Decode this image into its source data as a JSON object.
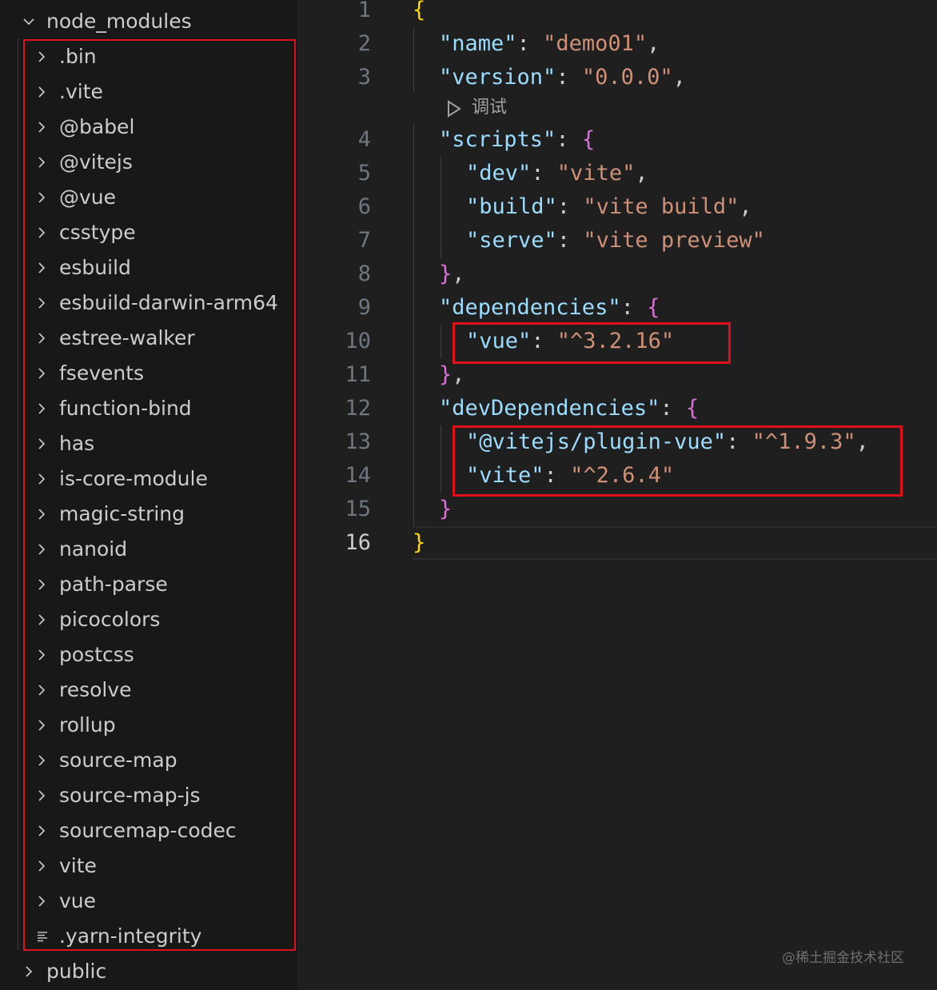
{
  "explorer": {
    "root_folder": "node_modules",
    "root_expanded": true,
    "items": [
      {
        "label": ".bin",
        "type": "folder"
      },
      {
        "label": ".vite",
        "type": "folder"
      },
      {
        "label": "@babel",
        "type": "folder"
      },
      {
        "label": "@vitejs",
        "type": "folder"
      },
      {
        "label": "@vue",
        "type": "folder"
      },
      {
        "label": "csstype",
        "type": "folder"
      },
      {
        "label": "esbuild",
        "type": "folder"
      },
      {
        "label": "esbuild-darwin-arm64",
        "type": "folder"
      },
      {
        "label": "estree-walker",
        "type": "folder"
      },
      {
        "label": "fsevents",
        "type": "folder"
      },
      {
        "label": "function-bind",
        "type": "folder"
      },
      {
        "label": "has",
        "type": "folder"
      },
      {
        "label": "is-core-module",
        "type": "folder"
      },
      {
        "label": "magic-string",
        "type": "folder"
      },
      {
        "label": "nanoid",
        "type": "folder"
      },
      {
        "label": "path-parse",
        "type": "folder"
      },
      {
        "label": "picocolors",
        "type": "folder"
      },
      {
        "label": "postcss",
        "type": "folder"
      },
      {
        "label": "resolve",
        "type": "folder"
      },
      {
        "label": "rollup",
        "type": "folder"
      },
      {
        "label": "source-map",
        "type": "folder"
      },
      {
        "label": "source-map-js",
        "type": "folder"
      },
      {
        "label": "sourcemap-codec",
        "type": "folder"
      },
      {
        "label": "vite",
        "type": "folder"
      },
      {
        "label": "vue",
        "type": "folder"
      },
      {
        "label": ".yarn-integrity",
        "type": "file"
      }
    ],
    "next_folder": "public",
    "icons": {
      "collapsed": "chevron-right-icon",
      "expanded": "chevron-down-icon",
      "file": "lines-file-icon"
    }
  },
  "editor": {
    "active_line": 16,
    "codelens_label": "调试",
    "codelens_icon": "play-outline-icon",
    "colors": {
      "key": "#9cdcfe",
      "string": "#ce9178",
      "bracket_level1": "#ffd700",
      "bracket_level2": "#da70d6",
      "punctuation": "#cccccc",
      "highlight_box": "#e0101a"
    },
    "lines": [
      {
        "num": "1",
        "tokens": [
          {
            "t": "{",
            "c": "b1"
          }
        ]
      },
      {
        "num": "2",
        "tokens": [
          {
            "t": "\"name\"",
            "c": "k"
          },
          {
            "t": ": ",
            "c": "p"
          },
          {
            "t": "\"demo01\"",
            "c": "s"
          },
          {
            "t": ",",
            "c": "p"
          }
        ]
      },
      {
        "num": "3",
        "tokens": [
          {
            "t": "\"version\"",
            "c": "k"
          },
          {
            "t": ": ",
            "c": "p"
          },
          {
            "t": "\"0.0.0\"",
            "c": "s"
          },
          {
            "t": ",",
            "c": "p"
          }
        ]
      },
      {
        "num": "4",
        "tokens": [
          {
            "t": "\"scripts\"",
            "c": "k"
          },
          {
            "t": ": ",
            "c": "p"
          },
          {
            "t": "{",
            "c": "b2"
          }
        ]
      },
      {
        "num": "5",
        "tokens": [
          {
            "t": "\"dev\"",
            "c": "k"
          },
          {
            "t": ": ",
            "c": "p"
          },
          {
            "t": "\"vite\"",
            "c": "s"
          },
          {
            "t": ",",
            "c": "p"
          }
        ]
      },
      {
        "num": "6",
        "tokens": [
          {
            "t": "\"build\"",
            "c": "k"
          },
          {
            "t": ": ",
            "c": "p"
          },
          {
            "t": "\"vite build\"",
            "c": "s"
          },
          {
            "t": ",",
            "c": "p"
          }
        ]
      },
      {
        "num": "7",
        "tokens": [
          {
            "t": "\"serve\"",
            "c": "k"
          },
          {
            "t": ": ",
            "c": "p"
          },
          {
            "t": "\"vite preview\"",
            "c": "s"
          }
        ]
      },
      {
        "num": "8",
        "tokens": [
          {
            "t": "}",
            "c": "b2"
          },
          {
            "t": ",",
            "c": "p"
          }
        ]
      },
      {
        "num": "9",
        "tokens": [
          {
            "t": "\"dependencies\"",
            "c": "k"
          },
          {
            "t": ": ",
            "c": "p"
          },
          {
            "t": "{",
            "c": "b2"
          }
        ]
      },
      {
        "num": "10",
        "tokens": [
          {
            "t": "\"vue\"",
            "c": "k"
          },
          {
            "t": ": ",
            "c": "p"
          },
          {
            "t": "\"^3.2.16\"",
            "c": "s"
          }
        ]
      },
      {
        "num": "11",
        "tokens": [
          {
            "t": "}",
            "c": "b2"
          },
          {
            "t": ",",
            "c": "p"
          }
        ]
      },
      {
        "num": "12",
        "tokens": [
          {
            "t": "\"devDependencies\"",
            "c": "k"
          },
          {
            "t": ": ",
            "c": "p"
          },
          {
            "t": "{",
            "c": "b2"
          }
        ]
      },
      {
        "num": "13",
        "tokens": [
          {
            "t": "\"@vitejs/plugin-vue\"",
            "c": "k"
          },
          {
            "t": ": ",
            "c": "p"
          },
          {
            "t": "\"^1.9.3\"",
            "c": "s"
          },
          {
            "t": ",",
            "c": "p"
          }
        ]
      },
      {
        "num": "14",
        "tokens": [
          {
            "t": "\"vite\"",
            "c": "k"
          },
          {
            "t": ": ",
            "c": "p"
          },
          {
            "t": "\"^2.6.4\"",
            "c": "s"
          }
        ]
      },
      {
        "num": "15",
        "tokens": [
          {
            "t": "}",
            "c": "b2"
          }
        ]
      },
      {
        "num": "16",
        "tokens": [
          {
            "t": "}",
            "c": "b1"
          }
        ]
      }
    ]
  },
  "watermark": "@稀土掘金技术社区"
}
